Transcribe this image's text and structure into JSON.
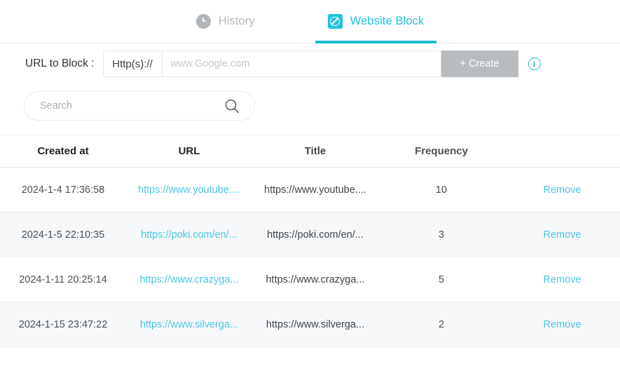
{
  "tabs": [
    {
      "label": "History",
      "icon": "clock-icon",
      "active": false
    },
    {
      "label": "Website Block",
      "icon": "block-icon",
      "active": true
    }
  ],
  "url_form": {
    "label": "URL to Block :",
    "prefix": "Http(s)://",
    "placeholder": "www.Google.com",
    "value": "",
    "create_label": "+ Create",
    "info_glyph": "i"
  },
  "search": {
    "placeholder": "Search",
    "value": ""
  },
  "table": {
    "headers": [
      "Created at",
      "URL",
      "Title",
      "Frequency",
      ""
    ],
    "action_label": "Remove",
    "rows": [
      {
        "created_at": "2024-1-4 17:36:58",
        "url": "https://www.youtube....",
        "title": "https://www.youtube....",
        "frequency": "10",
        "action": "Remove"
      },
      {
        "created_at": "2024-1-5 22:10:35",
        "url": "https://poki.com/en/...",
        "title": "https://poki.com/en/...",
        "frequency": "3",
        "action": "Remove"
      },
      {
        "created_at": "2024-1-11 20:25:14",
        "url": "https://www.crazyga...",
        "title": "https://www.crazyga...",
        "frequency": "5",
        "action": "Remove"
      },
      {
        "created_at": "2024-1-15 23:47:22",
        "url": "https://www.silverga...",
        "title": "https://www.silverga...",
        "frequency": "2",
        "action": "Remove"
      }
    ]
  },
  "colors": {
    "accent": "#1fc0dd",
    "link": "#4cc5e4",
    "disabled_button": "#b9bcbe",
    "inactive_tab": "#b4b9bd",
    "row_alt": "#f7f8fa"
  }
}
